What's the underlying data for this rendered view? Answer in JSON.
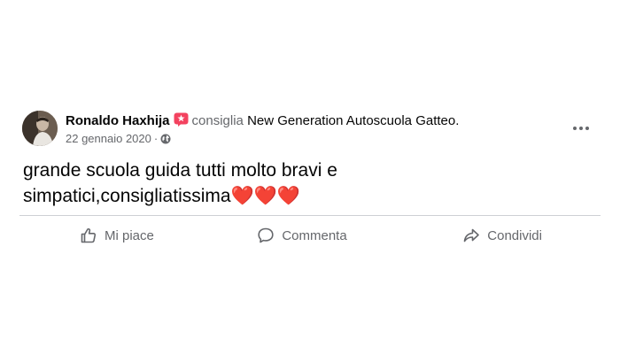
{
  "post": {
    "author_name": "Ronaldo Haxhija",
    "recommends_text": "consiglia",
    "page_name": "New Generation Autoscuola Gatteo",
    "period": ".",
    "date": "22 gennaio 2020",
    "date_separator": "·",
    "privacy_icon": "globe-icon",
    "body_text": "grande scuola guida tutti molto bravi e\nsimpatici,consigliatissima❤️❤️❤️"
  },
  "actions": {
    "like_label": "Mi piace",
    "comment_label": "Commenta",
    "share_label": "Condividi"
  },
  "colors": {
    "text_primary": "#050505",
    "text_secondary": "#65676b",
    "recommend_badge": "#f3425f",
    "divider": "#ced0d4"
  }
}
